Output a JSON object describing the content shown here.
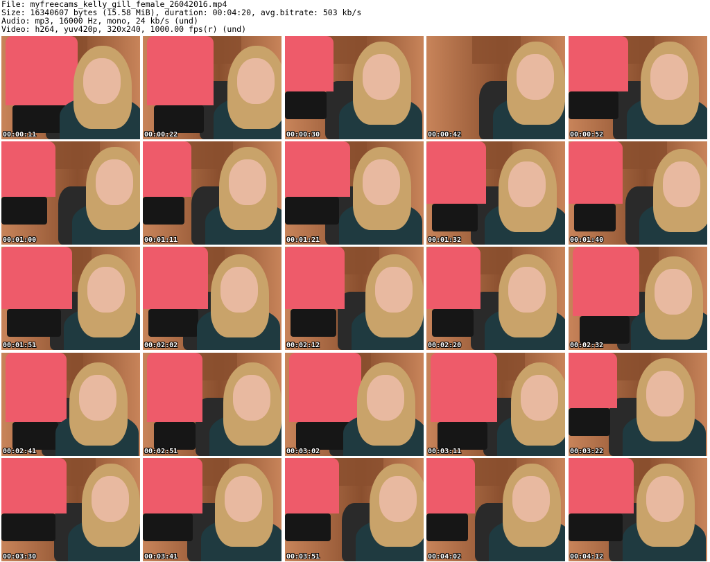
{
  "header": {
    "file_line": "File: myfreecams_kelly_gill_female_26042016.mp4",
    "size_line": "Size: 16340607 bytes (15.58 MiB), duration: 00:04:20, avg.bitrate: 503 kb/s",
    "audio_line": "Audio: mp3, 16000 Hz, mono, 24 kb/s (und)",
    "video_line": "Video: h264, yuv420p, 320x240, 1000.00 fps(r) (und)"
  },
  "thumbnails": [
    {
      "timestamp": "00:00:11"
    },
    {
      "timestamp": "00:00:22"
    },
    {
      "timestamp": "00:00:30"
    },
    {
      "timestamp": "00:00:42"
    },
    {
      "timestamp": "00:00:52"
    },
    {
      "timestamp": "00:01:00"
    },
    {
      "timestamp": "00:01:11"
    },
    {
      "timestamp": "00:01:21"
    },
    {
      "timestamp": "00:01:32"
    },
    {
      "timestamp": "00:01:40"
    },
    {
      "timestamp": "00:01:51"
    },
    {
      "timestamp": "00:02:02"
    },
    {
      "timestamp": "00:02:12"
    },
    {
      "timestamp": "00:02:20"
    },
    {
      "timestamp": "00:02:32"
    },
    {
      "timestamp": "00:02:41"
    },
    {
      "timestamp": "00:02:51"
    },
    {
      "timestamp": "00:03:02"
    },
    {
      "timestamp": "00:03:11"
    },
    {
      "timestamp": "00:03:22"
    },
    {
      "timestamp": "00:03:30"
    },
    {
      "timestamp": "00:03:41"
    },
    {
      "timestamp": "00:03:51"
    },
    {
      "timestamp": "00:04:02"
    },
    {
      "timestamp": "00:04:12"
    }
  ],
  "colors": {
    "background": "#ffffff",
    "wall": "#c8845a",
    "wall_dark": "#8a4f2e",
    "hair": "#c9a36a",
    "skin": "#e8b9a0",
    "sweater": "#1f3a40",
    "shirt": "#ee5b6a",
    "shorts": "#161616",
    "chair": "#2a2a2a",
    "timestamp_text": "#ffffff"
  }
}
